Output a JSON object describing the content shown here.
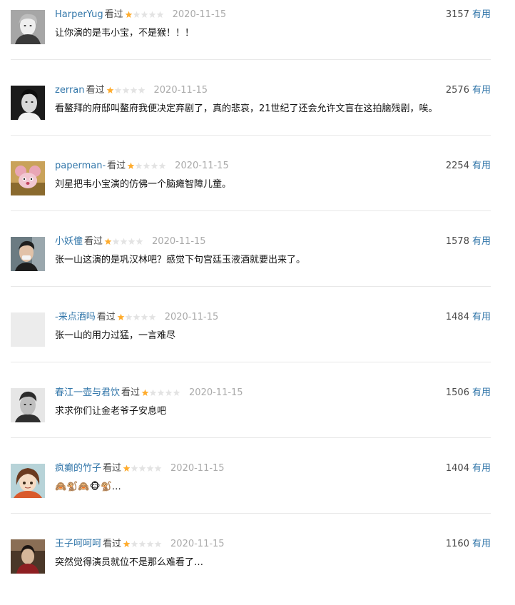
{
  "reviews": [
    {
      "user": "HarperYug",
      "status": "看过",
      "rating": 1,
      "date": "2020-11-15",
      "votes": "3157",
      "useful_label": "有用",
      "text": "让你演的是韦小宝，不是猴！！！",
      "avatar_icon": "bw-portrait-avatar"
    },
    {
      "user": "zerran",
      "status": "看过",
      "rating": 1,
      "date": "2020-11-15",
      "votes": "2576",
      "useful_label": "有用",
      "text": "看鳌拜的府邸叫鳌府我便决定弃剧了，真的悲哀，21世纪了还会允许文盲在这拍脑残剧，唉。",
      "avatar_icon": "bw-portrait-avatar"
    },
    {
      "user": "paperman-",
      "status": "看过",
      "rating": 1,
      "date": "2020-11-15",
      "votes": "2254",
      "useful_label": "有用",
      "text": "刘星把韦小宝演的仿佛一个脑瘫智障儿童。",
      "avatar_icon": "cartoon-mouse-avatar"
    },
    {
      "user": "小妖僮",
      "status": "看过",
      "rating": 1,
      "date": "2020-11-15",
      "votes": "1578",
      "useful_label": "有用",
      "text": "张一山这演的是巩汉林吧？感觉下句宫廷玉液酒就要出来了。",
      "avatar_icon": "photo-avatar"
    },
    {
      "user": "-来点酒吗",
      "status": "看过",
      "rating": 1,
      "date": "2020-11-15",
      "votes": "1484",
      "useful_label": "有用",
      "text": "张一山的用力过猛，一言难尽",
      "avatar_icon": "blank-avatar"
    },
    {
      "user": "春江一壶与君饮",
      "status": "看过",
      "rating": 1,
      "date": "2020-11-15",
      "votes": "1506",
      "useful_label": "有用",
      "text": "求求你们让金老爷子安息吧",
      "avatar_icon": "bw-portrait-avatar"
    },
    {
      "user": "疯癫的竹子",
      "status": "看过",
      "rating": 1,
      "date": "2020-11-15",
      "votes": "1404",
      "useful_label": "有用",
      "text": "🙈🐒🙈🐵🐒…",
      "avatar_icon": "anime-avatar"
    },
    {
      "user": "王子呵呵呵",
      "status": "看过",
      "rating": 1,
      "date": "2020-11-15",
      "votes": "1160",
      "useful_label": "有用",
      "text": "突然觉得演员就位不是那么难看了…",
      "avatar_icon": "photo-avatar"
    }
  ],
  "max_rating": 5,
  "colors": {
    "link": "#3377aa",
    "star_on": "#ffac2d",
    "star_off": "#e3e3e3",
    "date": "#aaaaaa",
    "text": "#111111"
  }
}
